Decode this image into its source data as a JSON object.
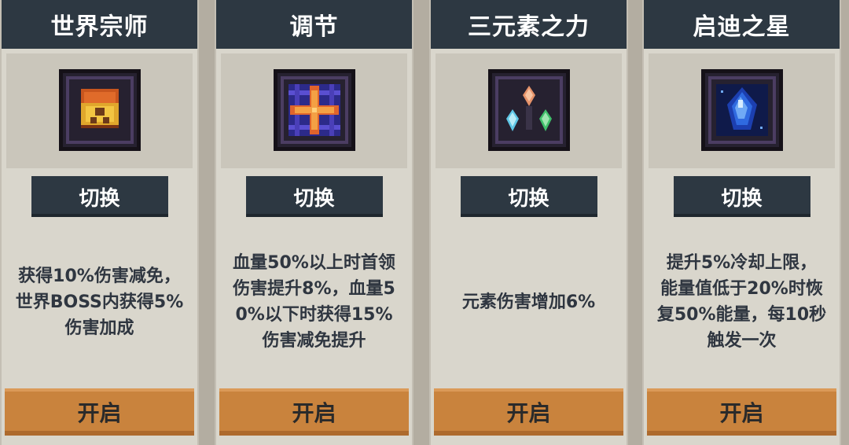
{
  "cards": [
    {
      "title": "世界宗师",
      "icon": "chest-gem-icon",
      "switch_label": "切换",
      "desc_lines": [
        "获得10%伤害减免，",
        "世界BOSS内获得5%",
        "伤害加成"
      ],
      "open_label": "开启"
    },
    {
      "title": "调节",
      "icon": "cross-star-icon",
      "switch_label": "切换",
      "desc_lines": [
        "血量50%以上时首领",
        "伤害提升8%，血量5",
        "0%以下时获得15%",
        "伤害减免提升"
      ],
      "open_label": "开启"
    },
    {
      "title": "三元素之力",
      "icon": "triple-crystal-icon",
      "switch_label": "切换",
      "desc_lines": [
        "元素伤害增加6%"
      ],
      "open_label": "开启"
    },
    {
      "title": "启迪之星",
      "icon": "blue-star-gem-icon",
      "switch_label": "切换",
      "desc_lines": [
        "提升5%冷却上限，",
        "能量值低于20%时恢",
        "复50%能量，每10秒",
        "触发一次"
      ],
      "open_label": "开启"
    }
  ]
}
